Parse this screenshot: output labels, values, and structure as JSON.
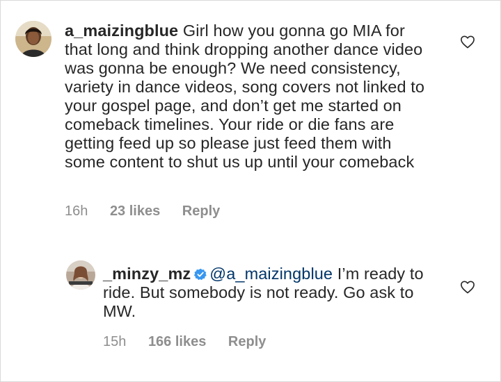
{
  "comments": [
    {
      "username": "a_maizingblue",
      "text": "Girl how you gonna go MIA for that long and think dropping another dance video was gonna be enough? We need consistency, variety in dance videos, song covers not linked to your gospel page, and don’t get me started on comeback timelines. Your ride or die fans are getting feed up so please just feed them with some content to shut us up until your comeback",
      "time": "16h",
      "likes": "23 likes",
      "reply": "Reply",
      "avatar_icon": "user-avatar-icon"
    },
    {
      "username": "_minzy_mz",
      "verified": true,
      "mention": "@a_maizingblue",
      "text": " I’m ready to ride. But somebody is not ready. Go ask to MW.",
      "time": "15h",
      "likes": "166 likes",
      "reply": "Reply",
      "avatar_icon": "user-avatar-icon"
    }
  ],
  "colors": {
    "text": "#262626",
    "meta": "#8e8e8e",
    "mention": "#003569",
    "verified_badge": "#3897f0"
  }
}
